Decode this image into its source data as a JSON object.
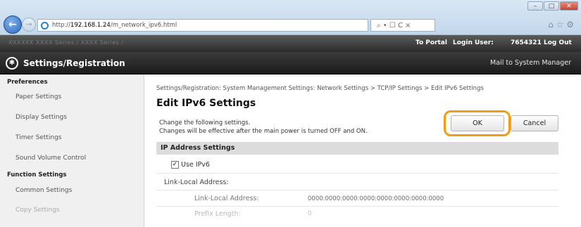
{
  "browser": {
    "url_prefix": "http://",
    "url_host": "192.168.1.24",
    "url_path": "/m_network_ipv6.html",
    "search_tools": "⌕ • ☐ C ×",
    "right_icons": "⌂ ☆ ⚙",
    "win_min": "–",
    "win_max": "□",
    "win_close": "✕",
    "back_glyph": "←",
    "fwd_glyph": "→"
  },
  "portal": {
    "device_name": "XXXXXX   XXXX Series / XXXX Series /",
    "to_portal": "To Portal",
    "login_label": "Login User:",
    "login_value": "7654321",
    "logout": "Log Out"
  },
  "app": {
    "title": "Settings/Registration",
    "mail_link": "Mail to System Manager",
    "settings_icon_glyph": "✱"
  },
  "sidebar": {
    "section1": "Preferences",
    "items1": [
      "Paper Settings",
      "Display Settings",
      "Timer Settings",
      "Sound Volume Control"
    ],
    "section2": "Function Settings",
    "items2": [
      "Common Settings",
      "Copy Settings"
    ]
  },
  "main": {
    "breadcrumb": "Settings/Registration: System Management Settings: Network Settings > TCP/IP Settings > Edit IPv6 Settings",
    "title": "Edit IPv6 Settings",
    "instruction1": "Change the following settings.",
    "instruction2": "Changes will be effective after the main power is turned OFF and ON.",
    "ok_label": "OK",
    "cancel_label": "Cancel",
    "section_title": "IP Address Settings",
    "use_ipv6_label": "Use IPv6",
    "use_ipv6_checked": "✓",
    "link_local_heading": "Link-Local Address:",
    "link_local_address_label": "Link-Local Address:",
    "link_local_address_value": "0000:0000:0000:0000:0000:0000:0000:0000",
    "prefix_length_label": "Prefix Length:",
    "prefix_length_value": "0"
  },
  "colors": {
    "highlight": "#f39c12",
    "title_bar": "#1c1c1c",
    "section_header": "#dcdcdc"
  }
}
